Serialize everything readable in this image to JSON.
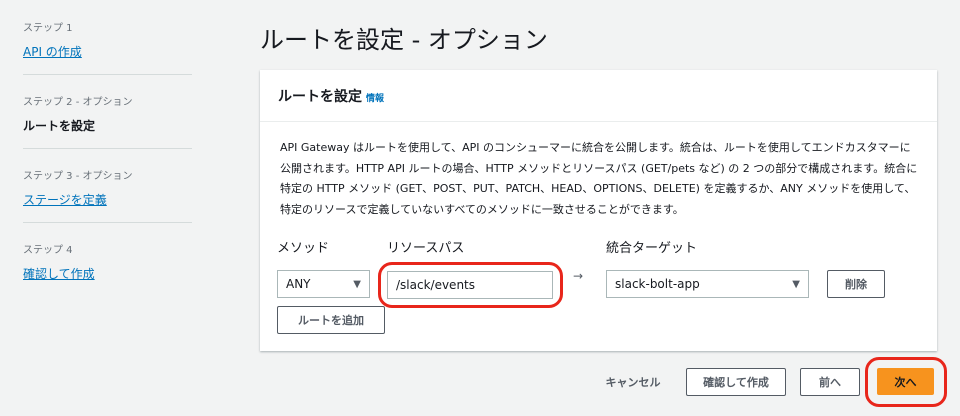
{
  "sidebar": {
    "steps": [
      {
        "label": "ステップ 1",
        "title": "API の作成",
        "link": true
      },
      {
        "label": "ステップ 2 - オプション",
        "title": "ルートを設定",
        "link": false
      },
      {
        "label": "ステップ 3 - オプション",
        "title": "ステージを定義",
        "link": true
      },
      {
        "label": "ステップ 4",
        "title": "確認して作成",
        "link": true
      }
    ]
  },
  "page_title": "ルートを設定 - オプション",
  "panel": {
    "title": "ルートを設定",
    "info": "情報",
    "description": "API Gateway はルートを使用して、API のコンシューマーに統合を公開します。統合は、ルートを使用してエンドカスタマーに公開されます。HTTP API ルートの場合、HTTP メソッドとリソースパス (GET/pets など) の 2 つの部分で構成されます。統合に特定の HTTP メソッド (GET、POST、PUT、PATCH、HEAD、OPTIONS、DELETE) を定義するか、ANY メソッドを使用して、特定のリソースで定義していないすべてのメソッドに一致させることができます。",
    "method_label": "メソッド",
    "path_label": "リソースパス",
    "target_label": "統合ターゲット",
    "method_value": "ANY",
    "path_value": "/slack/events",
    "arrow": "→",
    "target_value": "slack-bolt-app",
    "delete_label": "削除",
    "add_route_label": "ルートを追加"
  },
  "footer": {
    "cancel": "キャンセル",
    "review": "確認して作成",
    "prev": "前へ",
    "next": "次へ"
  },
  "colors": {
    "accent": "#ec7211",
    "link": "#0073bb",
    "annotation": "#e8261b"
  }
}
